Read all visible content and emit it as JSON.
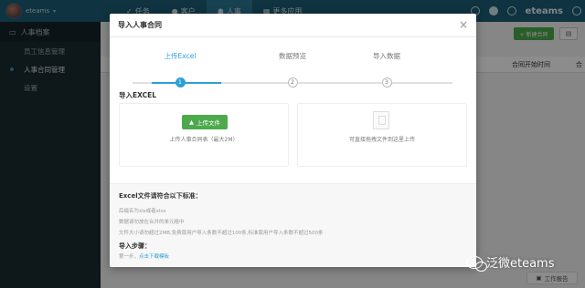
{
  "topbar": {
    "user_name": "eteams",
    "tabs": [
      {
        "label": "任务",
        "icon": "check-icon"
      },
      {
        "label": "客户",
        "icon": "user-icon"
      },
      {
        "label": "人事",
        "icon": "people-icon",
        "active": true
      },
      {
        "label": "更多应用",
        "icon": "grid-icon"
      }
    ],
    "brand": "eteams"
  },
  "sidebar": {
    "header": "人事档案",
    "items": [
      {
        "label": "员工信息管理"
      },
      {
        "label": "人事合同管理",
        "active": true
      },
      {
        "label": "设置"
      }
    ]
  },
  "main": {
    "new_button": "+ 新建合同",
    "table_headers": [
      "型",
      "合同开始时间",
      "合"
    ],
    "work_report": "工作报告"
  },
  "modal": {
    "title": "导入人事合同",
    "close": "×",
    "steps": [
      {
        "label": "上传Excel",
        "num": "1",
        "active": true
      },
      {
        "label": "数据预览",
        "num": "2"
      },
      {
        "label": "导入数据",
        "num": "3"
      }
    ],
    "section_title": "导入EXCEL",
    "upload_button": "上传文件",
    "upload_hint": "上传人事合同表（最大2M）",
    "drop_hint": "可直接拖拽文件到这里上传",
    "rules_title": "Excel文件请符合以下标准：",
    "rules": [
      "后缀名为xls或者xlsx",
      "数据请勿放在合并的单元格中",
      "文件大小请勿超过2MB,免费版用户导入条数不超过100条,标准版用户导入条数不超过500条"
    ],
    "steps_title": "导入步骤：",
    "step1_prefix": "第一步，",
    "step1_link": "点击下载模板"
  },
  "watermark": "泛微eteams",
  "colors": {
    "topbar": "#1d5d76",
    "accent": "#2aa1d6",
    "green": "#4ca94c",
    "sidebar": "#1b2a31"
  }
}
